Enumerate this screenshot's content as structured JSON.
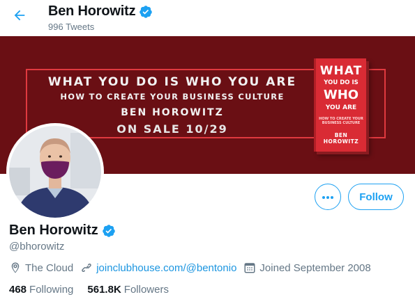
{
  "header": {
    "name": "Ben Horowitz",
    "tweet_count": "996 Tweets"
  },
  "banner": {
    "title": "WHAT YOU DO IS WHO YOU ARE",
    "subtitle": "HOW TO CREATE YOUR BUSINESS CULTURE",
    "author": "BEN HOROWITZ",
    "sale": "ON SALE 10/29",
    "book_cover": {
      "line1": "WHAT",
      "line2": "YOU DO IS",
      "line3": "WHO",
      "line4": "YOU ARE",
      "line5": "HOW TO CREATE YOUR BUSINESS CULTURE",
      "line6": "BEN HOROWITZ"
    }
  },
  "actions": {
    "follow_label": "Follow"
  },
  "profile": {
    "name": "Ben Horowitz",
    "handle": "@bhorowitz",
    "location": "The Cloud",
    "link": "joinclubhouse.com/@bentonio",
    "joined": "Joined September 2008"
  },
  "stats": {
    "following_count": "468",
    "following_label": "Following",
    "followers_count": "561.8K",
    "followers_label": "Followers"
  },
  "colors": {
    "accent": "#1da1f2",
    "banner_bg": "#6a0f14",
    "banner_frame": "#e0393f",
    "secondary_text": "#657786"
  },
  "icons": {
    "back": "arrow-left-icon",
    "verified": "verified-badge-icon",
    "more": "more-dots-icon",
    "location": "location-pin-icon",
    "link": "link-icon",
    "calendar": "calendar-icon"
  }
}
